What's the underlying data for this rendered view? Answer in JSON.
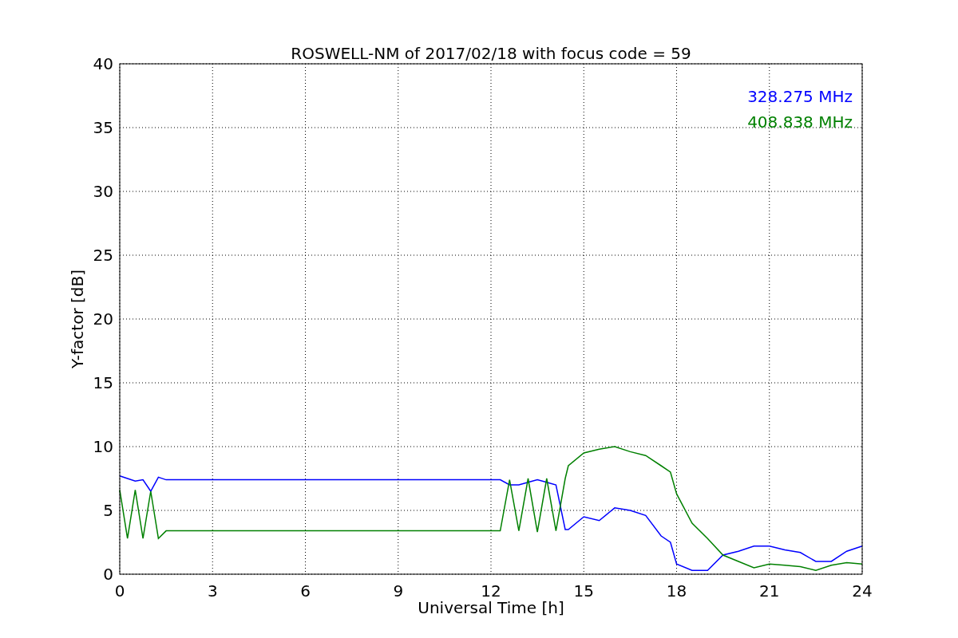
{
  "chart_data": {
    "type": "line",
    "title": "ROSWELL-NM of 2017/02/18 with focus code = 59",
    "xlabel": "Universal Time [h]",
    "ylabel": "Y-factor [dB]",
    "x": [
      0,
      0.25,
      0.5,
      0.75,
      1,
      1.25,
      1.5,
      12.3,
      12.6,
      12.9,
      13.2,
      13.5,
      13.8,
      14.1,
      14.4,
      14.5,
      15,
      15.5,
      16,
      16.5,
      17,
      17.5,
      17.8,
      18,
      18.5,
      19,
      19.5,
      20,
      20.5,
      21,
      21.5,
      22,
      22.5,
      23,
      23.5,
      24
    ],
    "series": [
      {
        "name": "328.275 MHz",
        "color": "#0000ff",
        "values": [
          7.7,
          7.5,
          7.3,
          7.4,
          6.5,
          7.6,
          7.4,
          7.4,
          7.0,
          7.0,
          7.2,
          7.4,
          7.2,
          7.0,
          3.5,
          3.5,
          4.5,
          4.2,
          5.2,
          5.0,
          4.6,
          3.0,
          2.5,
          0.8,
          0.3,
          0.3,
          1.5,
          1.8,
          2.2,
          2.2,
          1.9,
          1.7,
          1.0,
          1.0,
          1.8,
          2.2
        ]
      },
      {
        "name": "408.838 MHz",
        "color": "#008000",
        "values": [
          6.6,
          2.8,
          6.6,
          2.8,
          6.5,
          2.8,
          3.4,
          3.4,
          7.4,
          3.4,
          7.5,
          3.3,
          7.5,
          3.4,
          7.5,
          8.5,
          9.5,
          9.8,
          10.0,
          9.6,
          9.3,
          8.5,
          8.0,
          6.3,
          4.0,
          2.8,
          1.5,
          1.0,
          0.5,
          0.8,
          0.7,
          0.6,
          0.3,
          0.7,
          0.9,
          0.8
        ]
      }
    ],
    "grid": true,
    "xlim": [
      0,
      24
    ],
    "ylim": [
      0,
      40
    ],
    "xticks": [
      0,
      3,
      6,
      9,
      12,
      15,
      18,
      21,
      24
    ],
    "yticks": [
      0,
      5,
      10,
      15,
      20,
      25,
      30,
      35,
      40
    ]
  }
}
